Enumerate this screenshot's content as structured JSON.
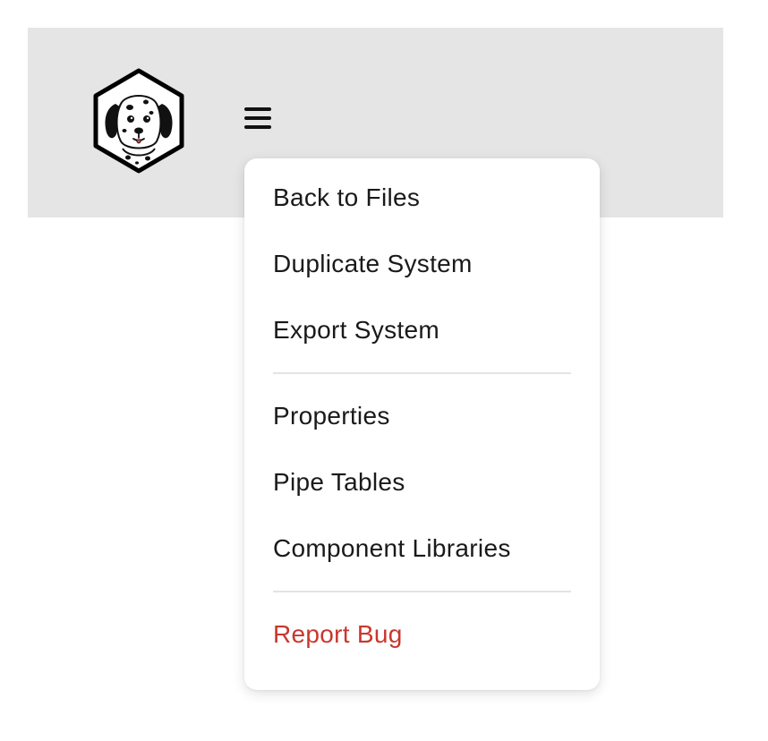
{
  "header": {
    "logo_icon": "dalmatian-logo-icon",
    "menu_icon": "hamburger-menu-icon",
    "background_color": "#e5e5e5"
  },
  "menu": {
    "groups": [
      {
        "items": [
          {
            "label": "Back to Files"
          },
          {
            "label": "Duplicate System"
          },
          {
            "label": "Export System"
          }
        ]
      },
      {
        "items": [
          {
            "label": "Properties"
          },
          {
            "label": "Pipe Tables"
          },
          {
            "label": "Component Libraries"
          }
        ]
      },
      {
        "items": [
          {
            "label": "Report Bug",
            "color": "#c8372d"
          }
        ]
      }
    ]
  }
}
